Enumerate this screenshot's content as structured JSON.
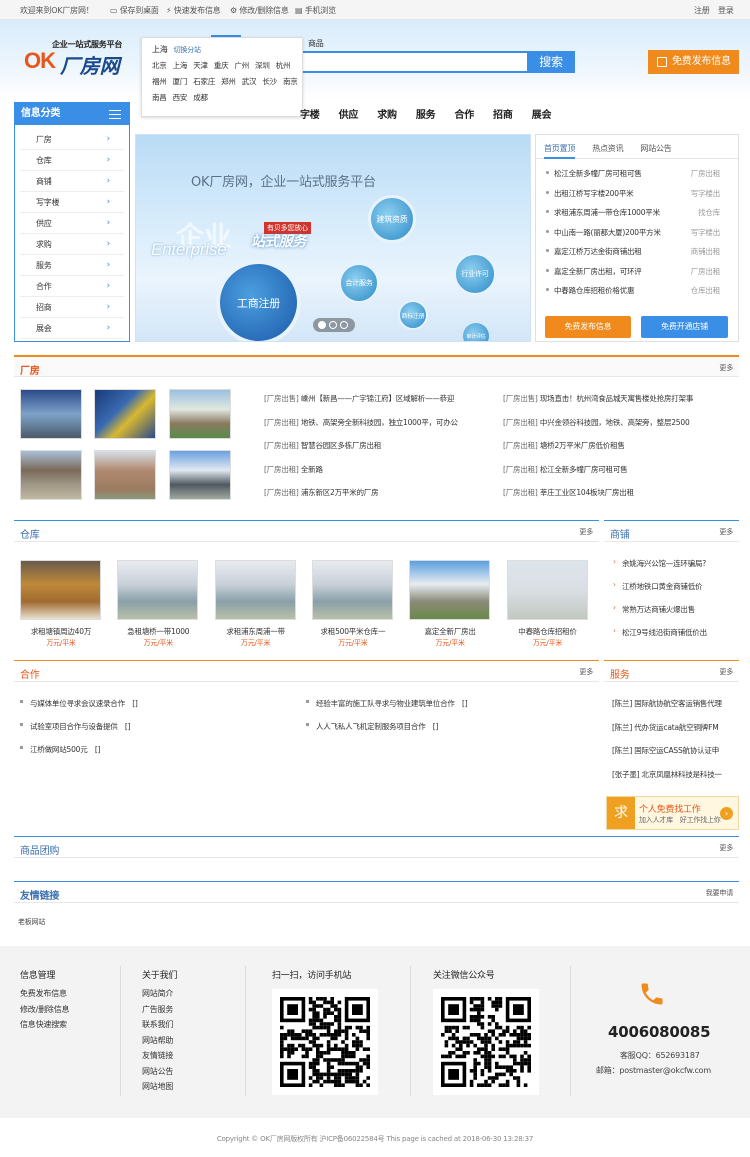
{
  "topbar": {
    "welcome": "欢迎来到OK厂房网！",
    "save_desktop": "保存到桌面",
    "quick_publish": "快速发布信息",
    "modify_delete": "修改/删除信息",
    "mobile": "手机浏览",
    "register": "注册",
    "login": "登录"
  },
  "logo": {
    "slogan": "企业一站式服务平台",
    "ok": "OK",
    "name": "厂房网"
  },
  "search": {
    "tab_goods": "商品",
    "button": "搜索",
    "placeholder": ""
  },
  "publish_button": "免费发布信息",
  "city_popup": {
    "current": "上海",
    "switch": "切换分站",
    "rows": [
      [
        "北京",
        "上海",
        "天津",
        "重庆",
        "广州",
        "深圳",
        "杭州"
      ],
      [
        "福州",
        "厦门",
        "石家庄",
        "郑州",
        "武汉",
        "长沙",
        "南京"
      ],
      [
        "南昌",
        "西安",
        "成都"
      ]
    ]
  },
  "sidebar": {
    "title": "信息分类",
    "items": [
      "厂房",
      "仓库",
      "商铺",
      "写字楼",
      "供应",
      "求购",
      "服务",
      "合作",
      "招商",
      "展会"
    ]
  },
  "nav": [
    "字楼",
    "供应",
    "求购",
    "服务",
    "合作",
    "招商",
    "展会"
  ],
  "banner": {
    "title": "OK厂房网，企业一站式服务平台",
    "big": "企业",
    "tag": "有贝多您放心",
    "service": "站式服务",
    "en": "Enterprise",
    "c1": "工商注册",
    "c2": "建筑资质",
    "c3": "会计服务",
    "c4": "行业许可",
    "c5": "商标注册",
    "c6": "审计评估"
  },
  "newsbox": {
    "tabs": [
      "首页置顶",
      "热点资讯",
      "网站公告"
    ],
    "items": [
      {
        "t": "松江全新多幢厂房可租可售",
        "c": "厂房出租"
      },
      {
        "t": "出租江桥写字楼200平米",
        "c": "写字楼出"
      },
      {
        "t": "求租浦东周浦一带仓库1000平米",
        "c": "找仓库"
      },
      {
        "t": "中山南一路(丽都大厦)200平方米",
        "c": "写字楼出"
      },
      {
        "t": "嘉定江桥万达金街商铺出租",
        "c": "商铺出租"
      },
      {
        "t": "嘉定全新厂房出租，可环评",
        "c": "厂房出租"
      },
      {
        "t": "中春路仓库招租价格优惠",
        "c": "仓库出租"
      }
    ],
    "btn_publish": "免费发布信息",
    "btn_shop": "免费开通店铺"
  },
  "sections": {
    "factory": {
      "name": "厂房",
      "more": "更多"
    },
    "warehouse": {
      "name": "仓库",
      "more": "更多"
    },
    "shops": {
      "name": "商铺",
      "more": "更多"
    },
    "coop": {
      "name": "合作",
      "more": "更多"
    },
    "service": {
      "name": "服务",
      "more": "更多"
    },
    "goods": {
      "name": "商品团购",
      "more": "更多"
    },
    "links": {
      "name": "友情链接",
      "more": "我要申请"
    }
  },
  "factory_list_left": [
    {
      "k": "[厂房出售]",
      "t": " 嵊州【新昌——广宇锦江府】区域解析——恭迎"
    },
    {
      "k": "[厂房出租]",
      "t": " 地铁、高架旁全新科技园，独立1000平，可办公"
    },
    {
      "k": "[厂房出租]",
      "t": " 智慧谷园区多栋厂房出租"
    },
    {
      "k": "[厂房出租]",
      "t": " 全新路"
    },
    {
      "k": "[厂房出租]",
      "t": " 浦东新区2万平米的厂房"
    }
  ],
  "factory_list_right": [
    {
      "k": "[厂房出售]",
      "t": " 现场直击！杭州湾食品城天寓售楼处抢房打架事"
    },
    {
      "k": "[厂房出租]",
      "t": " 中兴金领谷科技园，地铁、高架旁，整层2500"
    },
    {
      "k": "[厂房出租]",
      "t": " 塘桥2万平米厂房低价租售"
    },
    {
      "k": "[厂房出租]",
      "t": " 松江全新多幢厂房可租可售"
    },
    {
      "k": "[厂房出租]",
      "t": " 莘庄工业区104板块厂房出租"
    }
  ],
  "warehouse_items": [
    {
      "t": "求租塘镇周边40万",
      "p": "万元/平米"
    },
    {
      "t": "急租塘桥一带1000",
      "p": "万元/平米"
    },
    {
      "t": "求租浦东周浦一带",
      "p": "万元/平米"
    },
    {
      "t": "求租500平米仓库一",
      "p": "万元/平米"
    },
    {
      "t": "嘉定全新厂房出",
      "p": "万元/平米"
    },
    {
      "t": "中春路仓库招租价",
      "p": "万元/平米"
    }
  ],
  "shops_list": [
    "余姚海兴公馆—连环骗局?",
    "江桥地铁口黄金商铺低价",
    "常熟万达商铺火爆出售",
    "松江9号线沿街商铺低价出"
  ],
  "coop_left": [
    "与媒体单位寻求会议速录合作　[]",
    "试验室项目合作与设备提供　[]",
    "江桥做网站500元　[]"
  ],
  "coop_right": [
    "经验丰富的施工队寻求与物业建筑单位合作　[]",
    "人人飞私人飞机定制服务项目合作　[]"
  ],
  "service_list": [
    "[陈兰] 国际航协航空客运销售代理",
    "[陈兰] 代办货运cata航空铜牌FM",
    "[陈兰] 国际空运CASS航协认证申",
    "[张子墨] 北京凤凰林科技是科技一"
  ],
  "job": {
    "q": "求",
    "t1": "个人免费找工作",
    "t2": "加入人才库　好工作找上你",
    "go": "›"
  },
  "links_item": "老板网站",
  "footer": {
    "col1": {
      "h": "信息管理",
      "items": [
        "免费发布信息",
        "修改/删除信息",
        "信息快速搜索"
      ]
    },
    "col2": {
      "h": "关于我们",
      "items": [
        "网站简介",
        "广告服务",
        "联系我们",
        "网站帮助",
        "友情链接",
        "网站公告",
        "网站地图"
      ]
    },
    "qr1": "扫一扫，访问手机站",
    "qr2": "关注微信公众号",
    "phone": "4006080085",
    "qq": "客服QQ：652693187",
    "mail": "邮箱：postmaster@okcfw.com"
  },
  "copyright": "Copyright © OK厂房网版权所有 沪ICP备06022584号 This page is cached at 2018-06-30 13:28:37"
}
